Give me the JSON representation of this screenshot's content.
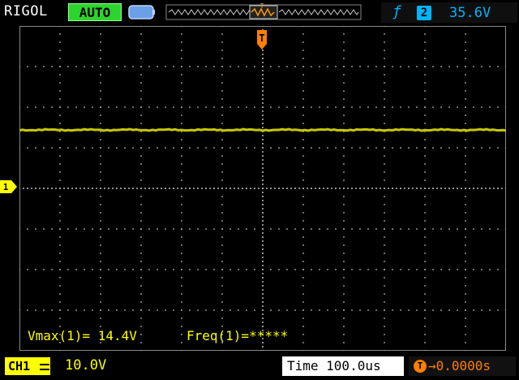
{
  "header": {
    "brand": "RIGOL",
    "run_status": "AUTO",
    "trigger": {
      "edge_symbol": "ƒ",
      "source": "2",
      "level": "35.6V"
    }
  },
  "screen": {
    "trigger_marker_label": "T",
    "ch1_marker_label": "1",
    "measurements": {
      "vmax": "Vmax(1)= 14.4V",
      "freq": "Freq(1)=*****"
    },
    "trace_color": "#c8c800"
  },
  "footer": {
    "ch1_tag": "CH1",
    "ch1_scale": "10.0V",
    "time_label": "Time 100.0us",
    "trigger_offset": "→0.0000s"
  },
  "colors": {
    "brand": "#ffffff",
    "run_status": "#2ed42e",
    "trigger": "#00b4ff",
    "channel1": "#ffff00",
    "trigger_offset": "#ff7f00",
    "grid_border": "#888888",
    "grid_dots": "#aaaaaa"
  },
  "icons": {
    "memory": "memory-depth-icon",
    "timebase": "timebase-waveform-icon",
    "trigger_edge": "rising-edge-icon",
    "trigger_marker": "trigger-position-icon",
    "ch1_marker": "ch1-ground-marker-icon"
  }
}
